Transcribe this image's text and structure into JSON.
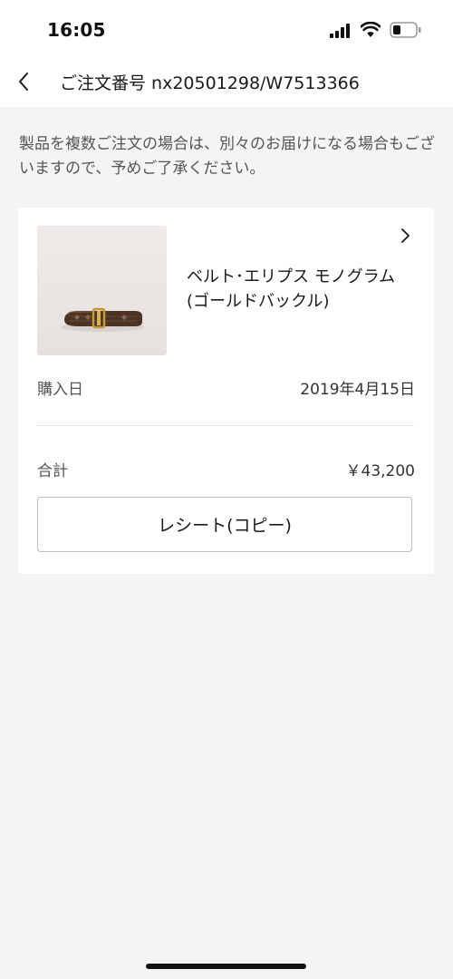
{
  "status_bar": {
    "time": "16:05"
  },
  "header": {
    "title": "ご注文番号 nx20501298/W7513366",
    "back_icon": "chevron-left-icon"
  },
  "notice": "製品を複数ご注文の場合は、別々のお届けになる場合もございますので、予めご了承ください。",
  "order": {
    "product": {
      "name": "ベルト･エリプス モノグラム(ゴールドバックル)",
      "image": "belt-product-image",
      "detail_icon": "chevron-right-icon"
    },
    "purchase_date_label": "購入日",
    "purchase_date": "2019年4月15日",
    "total_label": "合計",
    "total": "￥43,200",
    "receipt_button_label": "レシート(コピー)"
  },
  "colors": {
    "background": "#f4f4f4",
    "card": "#ffffff",
    "text": "#1a1a1a",
    "muted": "#555555",
    "border": "#bdbdbd"
  }
}
